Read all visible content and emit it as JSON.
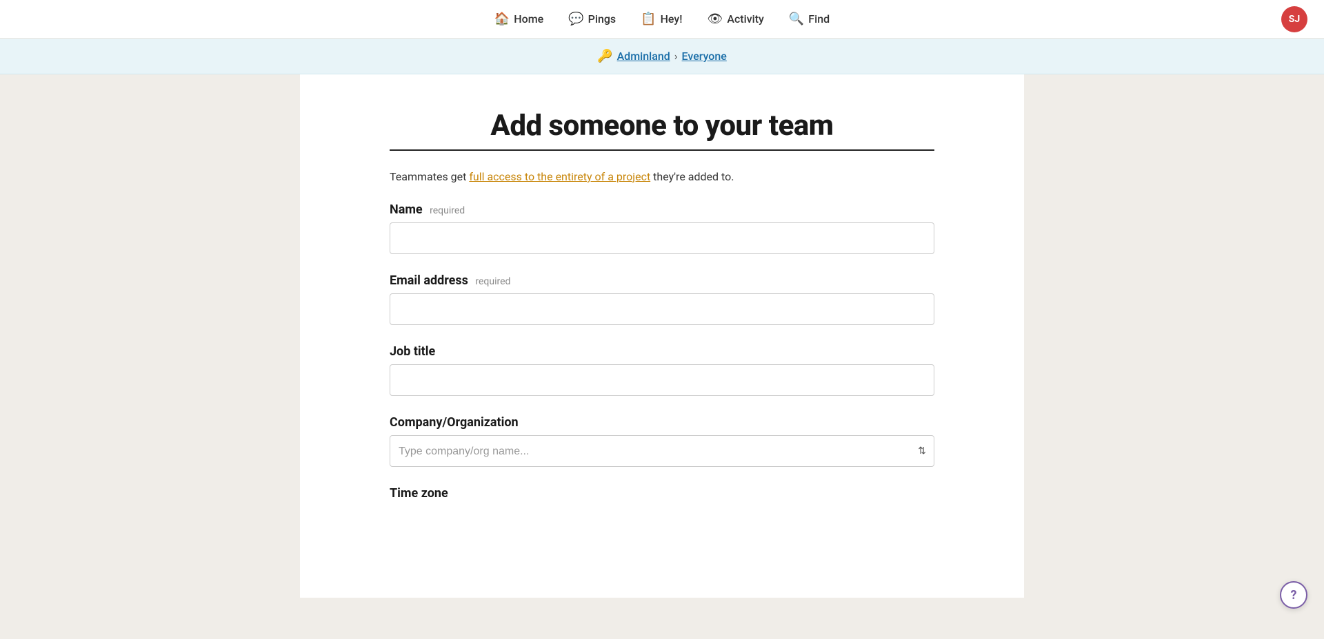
{
  "nav": {
    "items": [
      {
        "id": "home",
        "label": "Home",
        "icon": "🏠"
      },
      {
        "id": "pings",
        "label": "Pings",
        "icon": "💬"
      },
      {
        "id": "hey",
        "label": "Hey!",
        "icon": "📋"
      },
      {
        "id": "activity",
        "label": "Activity",
        "icon": "👁"
      },
      {
        "id": "find",
        "label": "Find",
        "icon": "🔍"
      }
    ],
    "avatar_initials": "SJ",
    "avatar_bg": "#d63f3f"
  },
  "breadcrumb": {
    "emoji": "🔑",
    "root_label": "Adminland",
    "separator": "›",
    "current_label": "Everyone"
  },
  "form": {
    "title": "Add someone to your team",
    "description_prefix": "Teammates get ",
    "description_link": "full access to the entirety of a project",
    "description_suffix": " they're added to.",
    "fields": [
      {
        "id": "name",
        "label": "Name",
        "required": true,
        "required_text": "required",
        "type": "text",
        "placeholder": ""
      },
      {
        "id": "email",
        "label": "Email address",
        "required": true,
        "required_text": "required",
        "type": "email",
        "placeholder": ""
      },
      {
        "id": "job_title",
        "label": "Job title",
        "required": false,
        "type": "text",
        "placeholder": ""
      },
      {
        "id": "company",
        "label": "Company/Organization",
        "required": false,
        "type": "select",
        "placeholder": "Type company/org name..."
      },
      {
        "id": "timezone",
        "label": "Time zone",
        "required": false,
        "type": "select",
        "placeholder": ""
      }
    ]
  },
  "help_button_label": "?"
}
